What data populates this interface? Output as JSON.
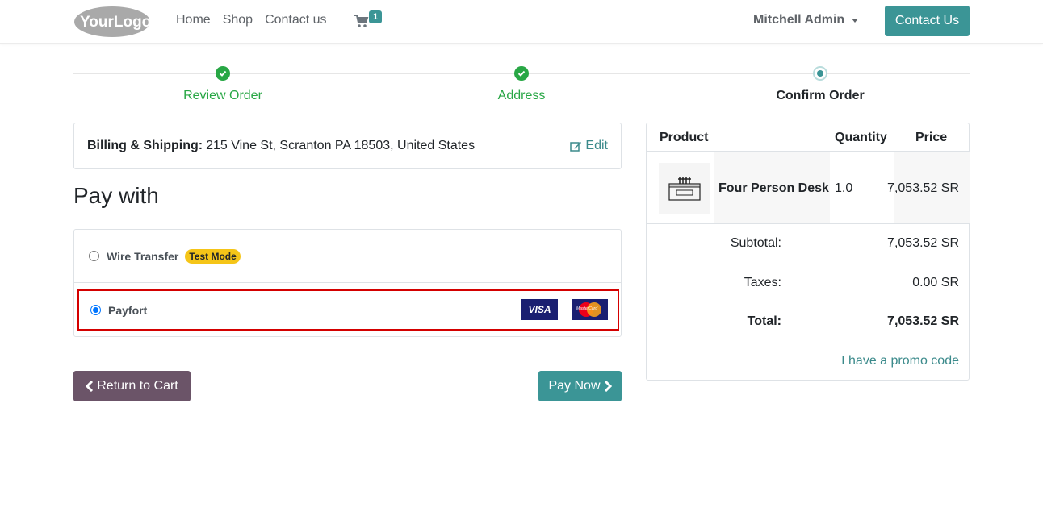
{
  "header": {
    "logo_text": "YourLogo",
    "nav": [
      "Home",
      "Shop",
      "Contact us"
    ],
    "cart_count": "1",
    "user_name": "Mitchell Admin",
    "contact_button": "Contact Us"
  },
  "wizard": {
    "steps": [
      {
        "label": "Review Order",
        "state": "done"
      },
      {
        "label": "Address",
        "state": "done"
      },
      {
        "label": "Confirm Order",
        "state": "current"
      }
    ]
  },
  "billing": {
    "label": "Billing & Shipping:",
    "address": "215 Vine St, Scranton PA 18503, United States",
    "edit_label": "Edit"
  },
  "payment": {
    "heading": "Pay with",
    "methods": [
      {
        "name": "Wire Transfer",
        "badge": "Test Mode",
        "selected": false
      },
      {
        "name": "Payfort",
        "selected": true,
        "card_logos": [
          "VISA",
          "MasterCard"
        ]
      }
    ]
  },
  "actions": {
    "return_label": "Return to Cart",
    "pay_label": "Pay Now"
  },
  "summary": {
    "columns": [
      "Product",
      "Quantity",
      "Price"
    ],
    "items": [
      {
        "name": "Four Person Desk",
        "quantity": "1.0",
        "price": "7,053.52 SR"
      }
    ],
    "subtotal_label": "Subtotal:",
    "subtotal": "7,053.52 SR",
    "taxes_label": "Taxes:",
    "taxes": "0.00 SR",
    "total_label": "Total:",
    "total": "7,053.52 SR",
    "promo_label": "I have a promo code"
  },
  "colors": {
    "primary": "#3b9596",
    "secondary": "#6b5468",
    "success": "#28a745",
    "highlight_border": "#d40000"
  }
}
